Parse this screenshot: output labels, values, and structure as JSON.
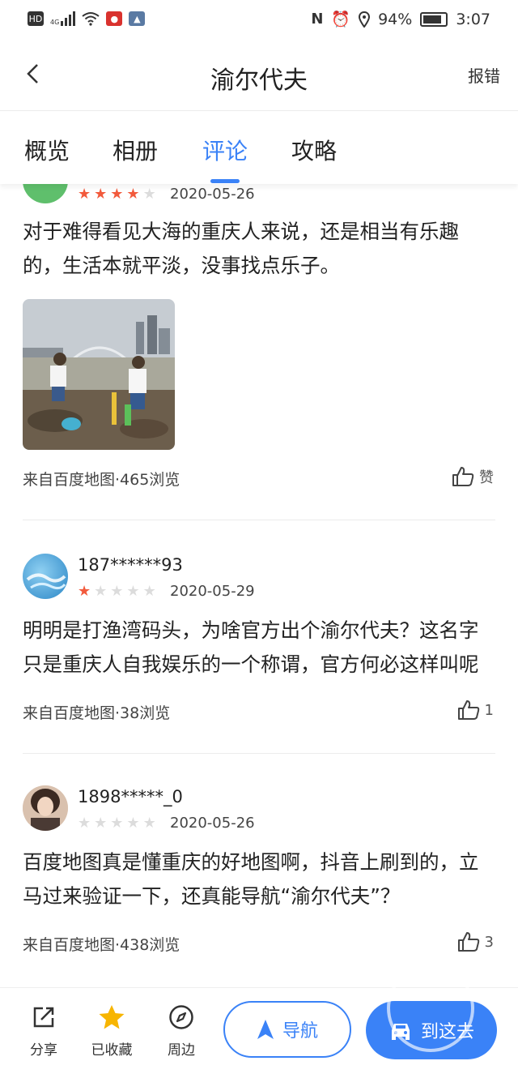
{
  "status_bar": {
    "left_badges": [
      "HD",
      "4G"
    ],
    "battery": "94%",
    "time": "3:07"
  },
  "header": {
    "title": "渝尔代夫",
    "report_label": "报错"
  },
  "tabs": [
    {
      "label": "概览"
    },
    {
      "label": "相册"
    },
    {
      "label": "评论"
    },
    {
      "label": "攻略"
    }
  ],
  "active_tab": "评论",
  "reviews": [
    {
      "username": "",
      "rating": 4,
      "date": "2020-05-26",
      "text": "对于难得看见大海的重庆人来说，还是相当有乐趣的，生活本就平淡，没事找点乐子。",
      "has_photo": true,
      "source": "来自百度地图·465浏览",
      "likes_label": "赞"
    },
    {
      "username": "187******93",
      "rating": 1,
      "date": "2020-05-29",
      "text": "明明是打渔湾码头，为啥官方出个渝尔代夫？这名字只是重庆人自我娱乐的一个称谓，官方何必这样叫呢",
      "has_photo": false,
      "source": "来自百度地图·38浏览",
      "likes_label": "1"
    },
    {
      "username": "1898*****_0",
      "rating": 0,
      "date": "2020-05-26",
      "text": "百度地图真是懂重庆的好地图啊，抖音上刷到的，立马过来验证一下，还真能导航“渝尔代夫”？",
      "has_photo": false,
      "source": "来自百度地图·438浏览",
      "likes_label": "3"
    }
  ],
  "bottom_bar": {
    "share": "分享",
    "favorited": "已收藏",
    "nearby": "周边",
    "navigate": "导航",
    "go_here": "到这去"
  },
  "colors": {
    "accent": "#3a82f7",
    "star_on": "#f25a3c",
    "star_off": "#dcdcdc",
    "favorite_star": "#f7b500"
  },
  "icons": [
    "back-icon",
    "share-icon",
    "star-icon",
    "compass-icon",
    "navigate-arrow-icon",
    "car-icon",
    "thumb-up-icon"
  ]
}
